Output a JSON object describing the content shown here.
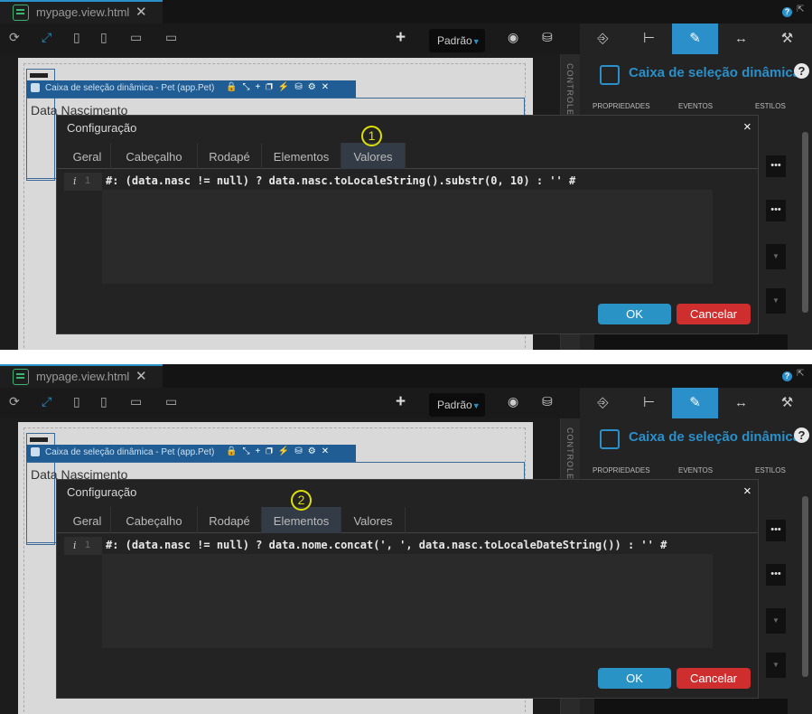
{
  "panels": [
    {
      "file_tab": {
        "label": "mypage.view.html",
        "close": "✕"
      },
      "toolbar": {
        "preset_label": "Padrão",
        "add": "+"
      },
      "component": {
        "label": "Caixa de seleção dinâmica - Pet (app.Pet)",
        "field_label": "Data Nascimento"
      },
      "controls_label": "CONTROLES",
      "right_panel": {
        "title": "Caixa de seleção dinâmica",
        "sub_tabs": [
          "PROPRIEDADES",
          "EVENTOS",
          "ESTILOS"
        ]
      },
      "dialog": {
        "title": "Configuração",
        "close": "×",
        "tabs": [
          "Geral",
          "Cabeçalho",
          "Rodapé",
          "Elementos",
          "Valores"
        ],
        "active_tab": "Valores",
        "line_number": "1",
        "code": "#: (data.nasc != null) ? data.nasc.toLocaleString().substr(0, 10) : '' #",
        "ok_label": "OK",
        "cancel_label": "Cancelar"
      },
      "step_marker": "1"
    },
    {
      "file_tab": {
        "label": "mypage.view.html",
        "close": "✕"
      },
      "toolbar": {
        "preset_label": "Padrão",
        "add": "+"
      },
      "component": {
        "label": "Caixa de seleção dinâmica - Pet (app.Pet)",
        "field_label": "Data Nascimento"
      },
      "controls_label": "CONTROLES",
      "right_panel": {
        "title": "Caixa de seleção dinâmica",
        "sub_tabs": [
          "PROPRIEDADES",
          "EVENTOS",
          "ESTILOS"
        ]
      },
      "dialog": {
        "title": "Configuração",
        "close": "×",
        "tabs": [
          "Geral",
          "Cabeçalho",
          "Rodapé",
          "Elementos",
          "Valores"
        ],
        "active_tab": "Elementos",
        "line_number": "1",
        "code": "#: (data.nasc != null) ? data.nome.concat(', ', data.nasc.toLocaleDateString()) : '' #",
        "ok_label": "OK",
        "cancel_label": "Cancelar"
      },
      "step_marker": "2"
    }
  ],
  "icons": {
    "left_toolbar": [
      "refresh-icon",
      "expand-icon",
      "mobile-icon",
      "tablet-icon",
      "desktop-icon",
      "monitor-icon"
    ],
    "right_toolbar": [
      "import-icon",
      "tree-icon",
      "pencil-icon",
      "resize-icon",
      "tools-icon"
    ]
  },
  "colors": {
    "accent": "#2b8fc9",
    "ok": "#2a93c5",
    "cancel": "#cf2e2e",
    "marker": "#dde000"
  }
}
